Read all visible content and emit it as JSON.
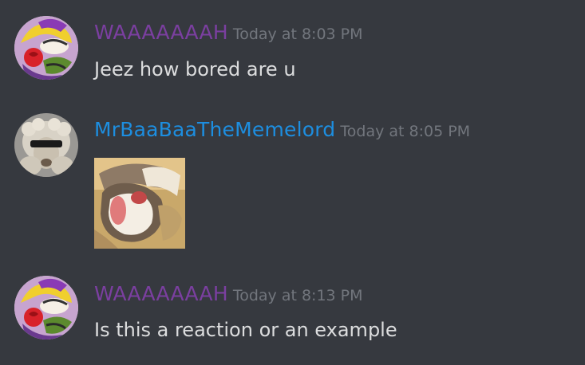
{
  "colors": {
    "background": "#36393f",
    "message_text": "#dcddde",
    "timestamp": "#72767d"
  },
  "messages": [
    {
      "author": "WAAAAAAAH",
      "author_color": "#7b3fa0",
      "timestamp": "Today at 8:03 PM",
      "text": "Jeez how bored are u",
      "avatar_icon": "wario-avatar-icon"
    },
    {
      "author": "MrBaaBaaTheMemelord",
      "author_color": "#1d8ee0",
      "timestamp": "Today at 8:05 PM",
      "attachment_icon": "reaction-image-icon",
      "avatar_icon": "sheep-sunglasses-avatar-icon"
    },
    {
      "author": "WAAAAAAAH",
      "author_color": "#7b3fa0",
      "timestamp": "Today at 8:13 PM",
      "text": "Is this a reaction or an example",
      "avatar_icon": "wario-avatar-icon"
    }
  ]
}
